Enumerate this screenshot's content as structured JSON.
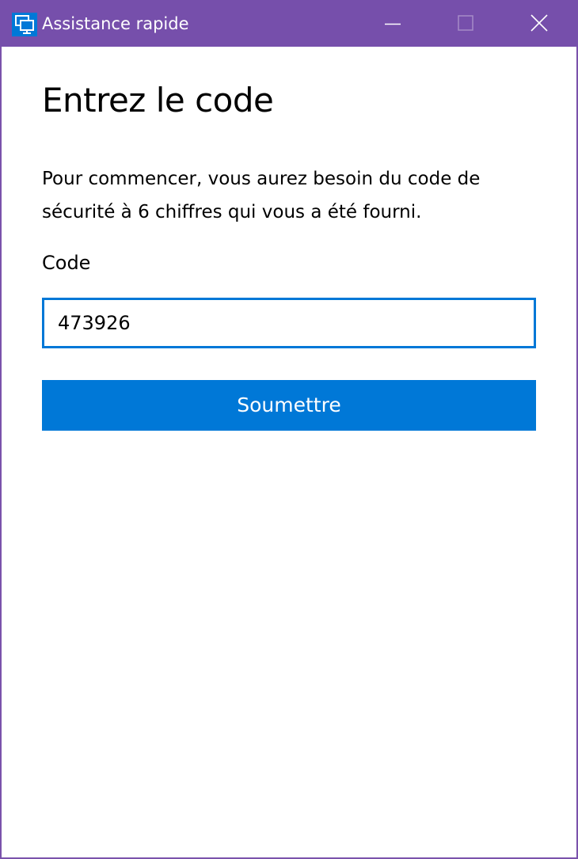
{
  "window": {
    "title": "Assistance rapide",
    "app_icon": "quick-assist-monitor-icon",
    "controls": [
      "minimize-icon",
      "maximize-icon",
      "close-icon"
    ]
  },
  "main": {
    "heading": "Entrez le code",
    "description": "Pour commencer, vous aurez besoin du code de sécurité à 6 chiffres qui vous a été fourni.",
    "code_label": "Code",
    "code_value": "473926",
    "submit_label": "Soumettre"
  },
  "colors": {
    "titlebar": "#764fab",
    "accent": "#0078d7",
    "window_border": "#7a52ab"
  }
}
